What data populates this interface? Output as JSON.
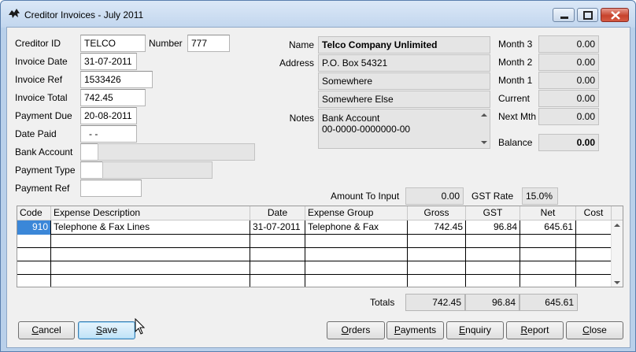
{
  "window": {
    "title": "Creditor Invoices - July 2011",
    "accent": "#3b87d8"
  },
  "left": {
    "creditor_id_label": "Creditor ID",
    "creditor_id": "TELCO",
    "number_label": "Number",
    "number": "777",
    "invoice_date_label": "Invoice Date",
    "invoice_date": "31-07-2011",
    "invoice_ref_label": "Invoice Ref",
    "invoice_ref": "1533426",
    "invoice_total_label": "Invoice Total",
    "invoice_total": "742.45",
    "payment_due_label": "Payment Due",
    "payment_due": "20-08-2011",
    "date_paid_label": "Date Paid",
    "date_paid": " - -",
    "bank_account_label": "Bank Account",
    "bank_account": "",
    "payment_type_label": "Payment Type",
    "payment_type": "",
    "payment_ref_label": "Payment Ref",
    "payment_ref": ""
  },
  "middle": {
    "name_label": "Name",
    "name": "Telco Company Unlimited",
    "address_label": "Address",
    "address1": "P.O. Box 54321",
    "address2": "Somewhere",
    "address3": "Somewhere Else",
    "notes_label": "Notes",
    "notes_line1": "Bank Account",
    "notes_line2": "00-0000-0000000-00",
    "amount_to_input_label": "Amount To Input",
    "amount_to_input": "0.00",
    "gst_rate_label": "GST Rate",
    "gst_rate": "15.0%"
  },
  "right": {
    "month3_label": "Month 3",
    "month3": "0.00",
    "month2_label": "Month 2",
    "month2": "0.00",
    "month1_label": "Month 1",
    "month1": "0.00",
    "current_label": "Current",
    "current": "0.00",
    "next_mth_label": "Next Mth",
    "next_mth": "0.00",
    "balance_label": "Balance",
    "balance": "0.00"
  },
  "grid": {
    "columns": [
      "Code",
      "Expense Description",
      "Date",
      "Expense Group",
      "Gross",
      "GST",
      "Net",
      "Cost"
    ],
    "rows": [
      {
        "code": "910",
        "description": "Telephone & Fax Lines",
        "date": "31-07-2011",
        "group": "Telephone & Fax",
        "gross": "742.45",
        "gst": "96.84",
        "net": "645.61",
        "cost": ""
      }
    ]
  },
  "totals": {
    "label": "Totals",
    "gross": "742.45",
    "gst": "96.84",
    "net": "645.61"
  },
  "buttons": {
    "cancel": {
      "mnemonic": "C",
      "rest": "ancel"
    },
    "save": {
      "mnemonic": "S",
      "rest": "ave"
    },
    "orders": {
      "mnemonic": "O",
      "rest": "rders"
    },
    "payments": {
      "mnemonic": "P",
      "rest": "ayments"
    },
    "enquiry": {
      "mnemonic": "E",
      "rest": "nquiry"
    },
    "report": {
      "mnemonic": "R",
      "rest": "eport"
    },
    "close": {
      "mnemonic": "C",
      "rest": "lose"
    }
  }
}
